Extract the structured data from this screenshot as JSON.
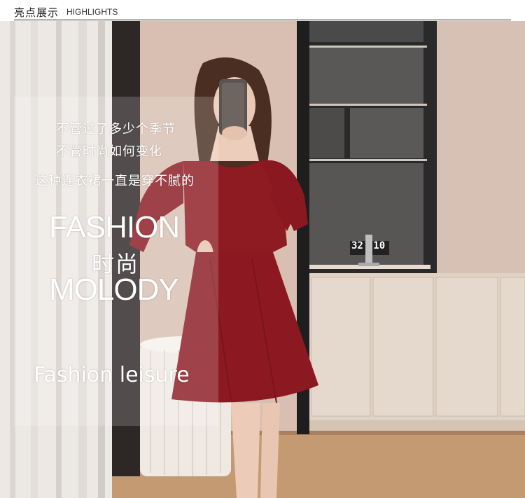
{
  "header": {
    "title_cn": "亮点展示",
    "title_en": "HIGHLIGHTS"
  },
  "overlay": {
    "line1": "不管过了多少个季节",
    "line2": "不管时尚如何变化",
    "line3": "这种连衣裙一直是穿不腻的",
    "fashion": "FASHION",
    "fashion_cn": "时尚",
    "molody": "MOLODY",
    "leisure": "Fashion leisure"
  },
  "phone_clock": {
    "hour": "10",
    "minute": "32"
  },
  "colors": {
    "wall": "#d9c0b2",
    "dress": "#8e1a22",
    "shelf": "#2b2b2b",
    "curtain": "#eeeae6"
  }
}
